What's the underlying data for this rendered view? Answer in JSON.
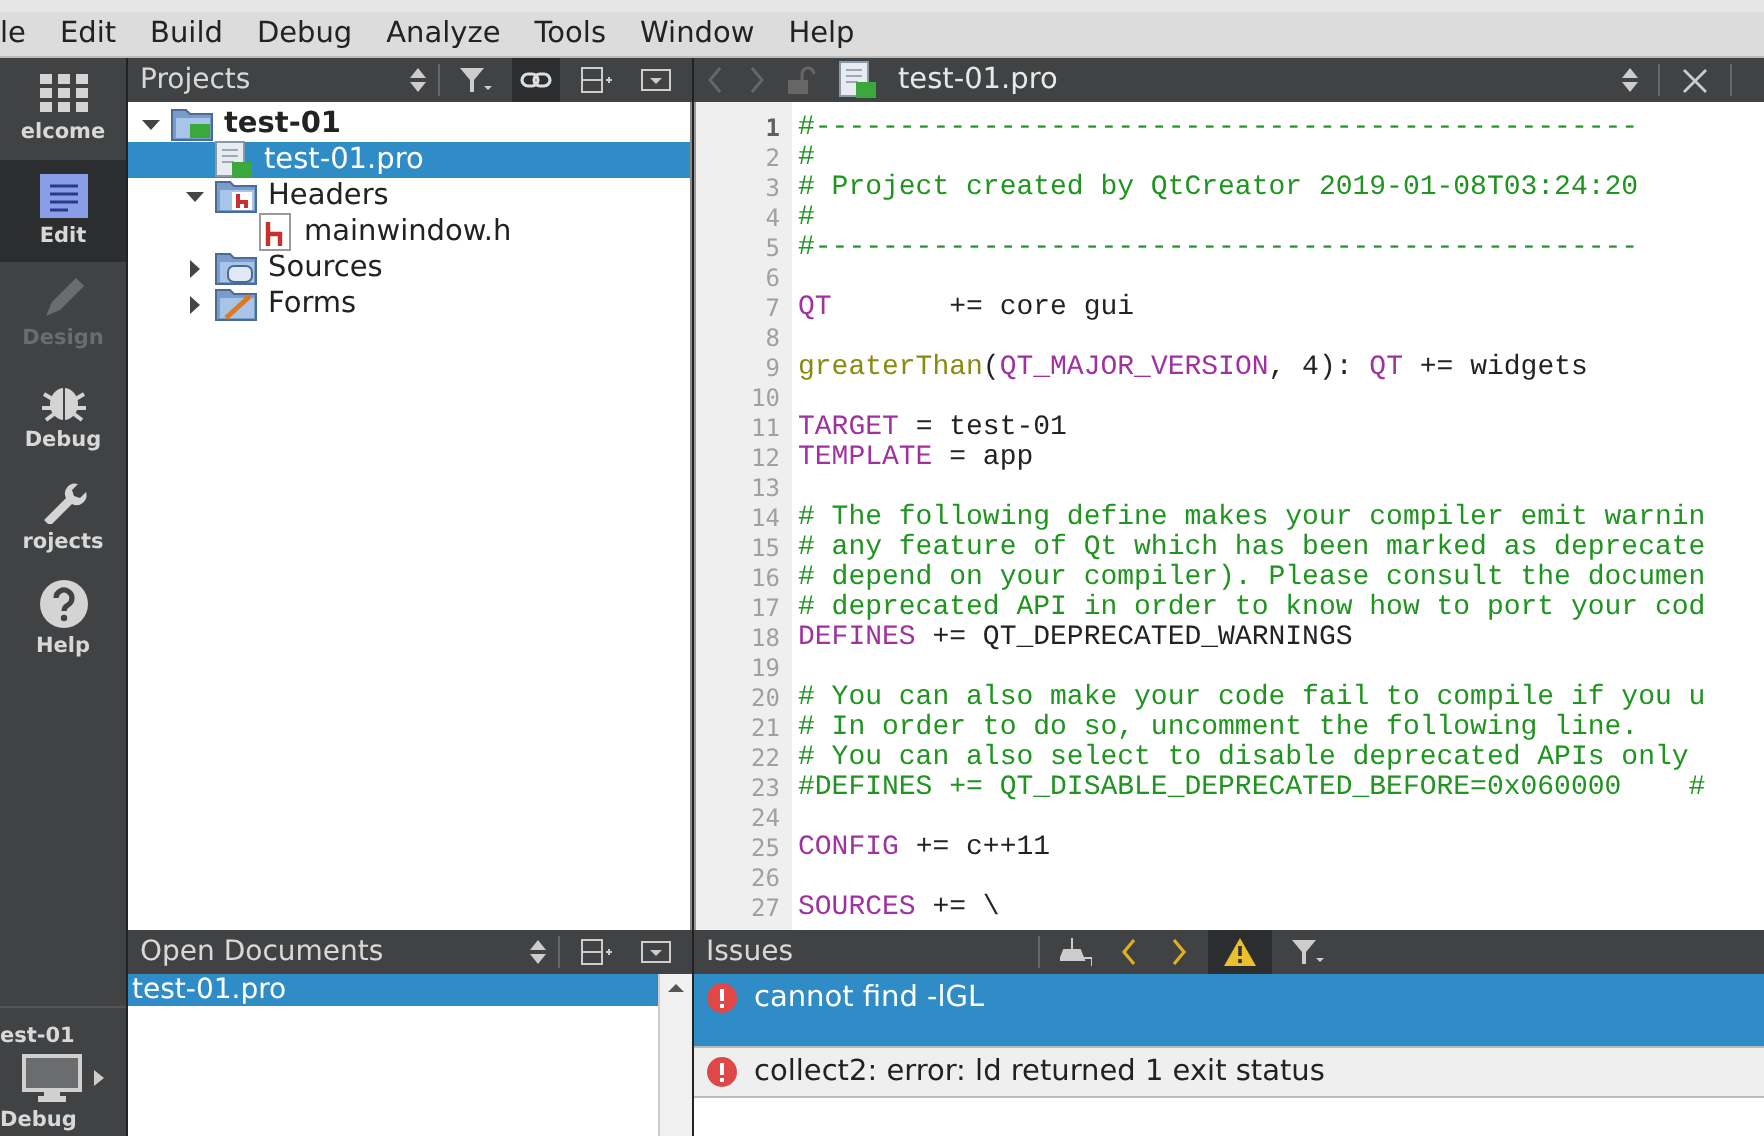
{
  "menu": [
    "le",
    "Edit",
    "Build",
    "Debug",
    "Analyze",
    "Tools",
    "Window",
    "Help"
  ],
  "modes": [
    {
      "label": "elcome",
      "kind": "grid",
      "selected": false,
      "disabled": false
    },
    {
      "label": "Edit",
      "kind": "edit",
      "selected": true,
      "disabled": false
    },
    {
      "label": "Design",
      "kind": "pencil",
      "selected": false,
      "disabled": true
    },
    {
      "label": "Debug",
      "kind": "bug",
      "selected": false,
      "disabled": false
    },
    {
      "label": "rojects",
      "kind": "wrench",
      "selected": false,
      "disabled": false
    },
    {
      "label": "Help",
      "kind": "help",
      "selected": false,
      "disabled": false
    }
  ],
  "kit": {
    "project": "est-01",
    "build": "Debug"
  },
  "projects": {
    "title": "Projects",
    "tree": [
      {
        "label": "test-01",
        "kind": "project",
        "expanded": true,
        "selected": false,
        "children": [
          {
            "label": "test-01.pro",
            "kind": "pro",
            "selected": true
          },
          {
            "label": "Headers",
            "kind": "headers",
            "expanded": true,
            "selected": false,
            "children": [
              {
                "label": "mainwindow.h",
                "kind": "header",
                "selected": false
              }
            ]
          },
          {
            "label": "Sources",
            "kind": "sources",
            "expanded": false,
            "selected": false
          },
          {
            "label": "Forms",
            "kind": "forms",
            "expanded": false,
            "selected": false
          }
        ]
      }
    ]
  },
  "open_documents": {
    "title": "Open Documents",
    "items": [
      {
        "label": "test-01.pro",
        "selected": true
      }
    ]
  },
  "editor": {
    "file": "test-01.pro",
    "lines": [
      {
        "number": "1",
        "current": true,
        "segments": [
          {
            "kind": "comment",
            "text": "#-------------------------------------------------"
          }
        ]
      },
      {
        "number": "2",
        "current": false,
        "segments": [
          {
            "kind": "comment",
            "text": "#"
          }
        ]
      },
      {
        "number": "3",
        "current": false,
        "segments": [
          {
            "kind": "comment",
            "text": "# Project created by QtCreator 2019-01-08T03:24:20"
          }
        ]
      },
      {
        "number": "4",
        "current": false,
        "segments": [
          {
            "kind": "comment",
            "text": "#"
          }
        ]
      },
      {
        "number": "5",
        "current": false,
        "segments": [
          {
            "kind": "comment",
            "text": "#-------------------------------------------------"
          }
        ]
      },
      {
        "number": "6",
        "current": false
      },
      {
        "number": "7",
        "current": false,
        "segments": [
          {
            "kind": "keyword",
            "text": "QT"
          },
          {
            "kind": "plain",
            "text": "       += core gui"
          }
        ]
      },
      {
        "number": "8",
        "current": false
      },
      {
        "number": "9",
        "current": false,
        "segments": [
          {
            "kind": "function",
            "text": "greaterThan"
          },
          {
            "kind": "plain",
            "text": "("
          },
          {
            "kind": "keyword",
            "text": "QT_MAJOR_VERSION"
          },
          {
            "kind": "plain",
            "text": ", 4): "
          },
          {
            "kind": "keyword",
            "text": "QT"
          },
          {
            "kind": "plain",
            "text": " += widgets"
          }
        ]
      },
      {
        "number": "10",
        "current": false
      },
      {
        "number": "11",
        "current": false,
        "segments": [
          {
            "kind": "keyword",
            "text": "TARGET"
          },
          {
            "kind": "plain",
            "text": " = test-01"
          }
        ]
      },
      {
        "number": "12",
        "current": false,
        "segments": [
          {
            "kind": "keyword",
            "text": "TEMPLATE"
          },
          {
            "kind": "plain",
            "text": " = app"
          }
        ]
      },
      {
        "number": "13",
        "current": false
      },
      {
        "number": "14",
        "current": false,
        "segments": [
          {
            "kind": "comment",
            "text": "# The following define makes your compiler emit warnin"
          }
        ]
      },
      {
        "number": "15",
        "current": false,
        "segments": [
          {
            "kind": "comment",
            "text": "# any feature of Qt which has been marked as deprecate"
          }
        ]
      },
      {
        "number": "16",
        "current": false,
        "segments": [
          {
            "kind": "comment",
            "text": "# depend on your compiler). Please consult the documen"
          }
        ]
      },
      {
        "number": "17",
        "current": false,
        "segments": [
          {
            "kind": "comment",
            "text": "# deprecated API in order to know how to port your cod"
          }
        ]
      },
      {
        "number": "18",
        "current": false,
        "segments": [
          {
            "kind": "keyword",
            "text": "DEFINES"
          },
          {
            "kind": "plain",
            "text": " += QT_DEPRECATED_WARNINGS"
          }
        ]
      },
      {
        "number": "19",
        "current": false
      },
      {
        "number": "20",
        "current": false,
        "segments": [
          {
            "kind": "comment",
            "text": "# You can also make your code fail to compile if you u"
          }
        ]
      },
      {
        "number": "21",
        "current": false,
        "segments": [
          {
            "kind": "comment",
            "text": "# In order to do so, uncomment the following line."
          }
        ]
      },
      {
        "number": "22",
        "current": false,
        "segments": [
          {
            "kind": "comment",
            "text": "# You can also select to disable deprecated APIs only"
          }
        ]
      },
      {
        "number": "23",
        "current": false,
        "segments": [
          {
            "kind": "comment",
            "text": "#DEFINES += QT_DISABLE_DEPRECATED_BEFORE=0x060000    #"
          }
        ]
      },
      {
        "number": "24",
        "current": false
      },
      {
        "number": "25",
        "current": false,
        "segments": [
          {
            "kind": "keyword",
            "text": "CONFIG"
          },
          {
            "kind": "plain",
            "text": " += c++11"
          }
        ]
      },
      {
        "number": "26",
        "current": false
      },
      {
        "number": "27",
        "current": false,
        "segments": [
          {
            "kind": "keyword",
            "text": "SOURCES"
          },
          {
            "kind": "plain",
            "text": " += \\"
          }
        ]
      }
    ]
  },
  "issues": {
    "title": "Issues",
    "items": [
      {
        "text": "cannot find -lGL",
        "selected": true
      },
      {
        "text": "collect2: error: ld returned 1 exit status",
        "selected": false
      }
    ]
  }
}
